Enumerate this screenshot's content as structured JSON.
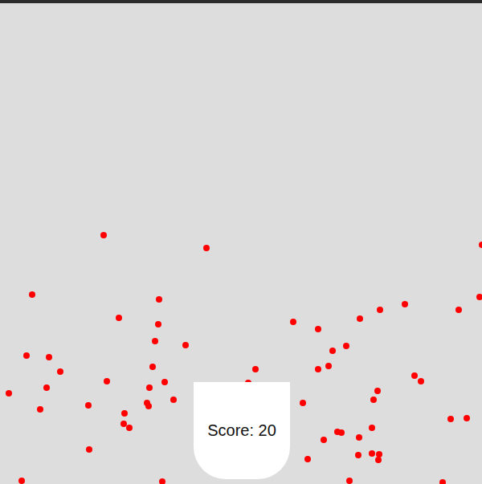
{
  "game": {
    "score": "Score: 20"
  }
}
